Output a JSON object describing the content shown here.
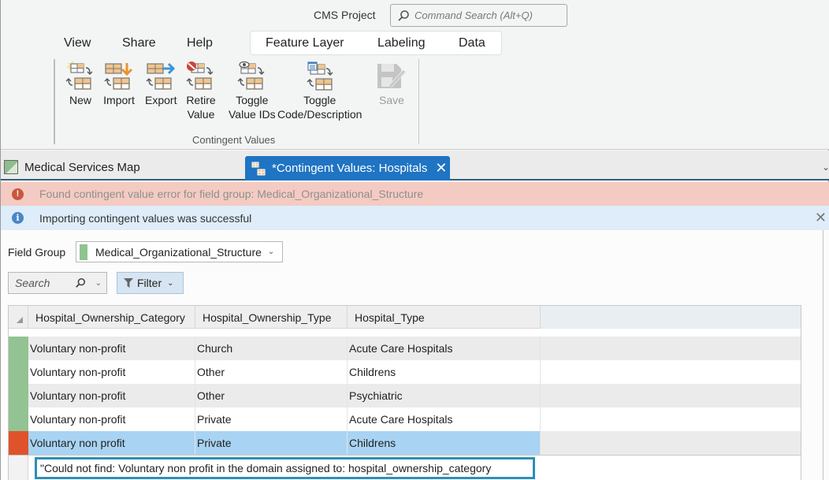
{
  "titlebar": {
    "project_title": "CMS Project",
    "command_search_placeholder": "Command Search (Alt+Q)"
  },
  "ribbon": {
    "tabs": [
      {
        "label": "View"
      },
      {
        "label": "Share"
      },
      {
        "label": "Help"
      }
    ],
    "contextual_tabs": [
      {
        "label": "Feature Layer"
      },
      {
        "label": "Labeling"
      },
      {
        "label": "Data"
      }
    ],
    "group_label": "Contingent Values",
    "buttons": [
      {
        "label": "New",
        "icon": "new-contingent-value-icon",
        "enabled": true
      },
      {
        "label": "Import",
        "icon": "import-icon",
        "enabled": true
      },
      {
        "label": "Export",
        "icon": "export-icon",
        "enabled": true
      },
      {
        "label": "Retire\nValue",
        "line1": "Retire",
        "line2": "Value",
        "icon": "retire-value-icon",
        "enabled": true
      },
      {
        "label": "Toggle\nValue IDs",
        "line1": "Toggle",
        "line2": "Value IDs",
        "icon": "toggle-value-ids-icon",
        "enabled": true
      },
      {
        "label": "Toggle\nCode/Description",
        "line1": "Toggle",
        "line2": "Code/Description",
        "icon": "toggle-code-description-icon",
        "enabled": true
      },
      {
        "label": "Save",
        "icon": "save-icon",
        "enabled": false
      }
    ]
  },
  "doc_tabs": {
    "map_tab": "Medical Services Map",
    "active_tab": "*Contingent Values: Hospitals",
    "close_glyph": "✕"
  },
  "messages": {
    "error": "Found contingent value error for field group: Medical_Organizational_Structure",
    "info": "Importing contingent values was successful",
    "close_glyph": "✕"
  },
  "field_group": {
    "label": "Field Group",
    "selected": "Medical_Organizational_Structure",
    "swatch_color": "#8fc48f"
  },
  "toolbar": {
    "search_placeholder": "Search",
    "filter_label": "Filter"
  },
  "grid": {
    "columns": [
      "Hospital_Ownership_Category",
      "Hospital_Ownership_Type",
      "Hospital_Type"
    ],
    "rows": [
      {
        "status": "valid",
        "status_color": "#93c393",
        "cells": [
          "Voluntary non-profit",
          "Church",
          "Acute Care Hospitals"
        ]
      },
      {
        "status": "valid",
        "status_color": "#93c393",
        "cells": [
          "Voluntary non-profit",
          "Other",
          "Childrens"
        ]
      },
      {
        "status": "valid",
        "status_color": "#93c393",
        "cells": [
          "Voluntary non-profit",
          "Other",
          "Psychiatric"
        ]
      },
      {
        "status": "valid",
        "status_color": "#93c393",
        "cells": [
          "Voluntary non-profit",
          "Private",
          "Acute Care Hospitals"
        ]
      },
      {
        "status": "error",
        "status_color": "#e0522b",
        "selected": true,
        "cells": [
          "Voluntary non profit",
          "Private",
          "Childrens"
        ]
      }
    ],
    "error_message": "\"Could not find: Voluntary non profit in the domain assigned to: hospital_ownership_category"
  },
  "colors": {
    "accent": "#1f74c3",
    "error_banner": "#f4cbc2",
    "info_banner": "#deedf9",
    "selected_row": "#a8d3f2",
    "error_tip_border": "#2e8fb6"
  }
}
